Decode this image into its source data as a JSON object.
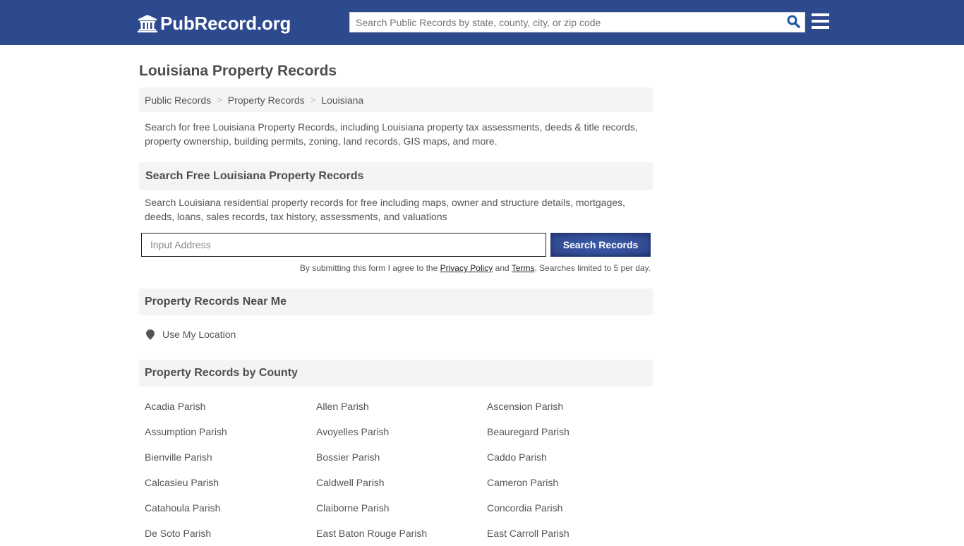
{
  "header": {
    "logo_text": "PubRecord.org",
    "search_placeholder": "Search Public Records by state, county, city, or zip code",
    "search_value": "",
    "icons": {
      "logo": "courthouse-icon",
      "search": "search-icon",
      "menu": "hamburger-menu-icon"
    },
    "colors": {
      "bar": "#2e4a8f",
      "search_icon": "#1d5a9e"
    }
  },
  "page": {
    "title": "Louisiana Property Records",
    "breadcrumb": [
      {
        "label": "Public Records"
      },
      {
        "label": "Property Records"
      },
      {
        "label": "Louisiana"
      }
    ],
    "breadcrumb_separator": ">",
    "intro": "Search for free Louisiana Property Records, including Louisiana property tax assessments, deeds & title records, property ownership, building permits, zoning, land records, GIS maps, and more."
  },
  "search_section": {
    "heading": "Search Free Louisiana Property Records",
    "description": "Search Louisiana residential property records for free including maps, owner and structure details, mortgages, deeds, loans, sales records, tax history, assessments, and valuations",
    "address_placeholder": "Input Address",
    "address_value": "",
    "button_label": "Search Records",
    "disclaimer": {
      "prefix": "By submitting this form I agree to the ",
      "privacy_link": "Privacy Policy",
      "middle": " and ",
      "terms_link": "Terms",
      "suffix": ". Searches limited to 5 per day."
    },
    "colors": {
      "button": "#334d96"
    }
  },
  "near_me": {
    "heading": "Property Records Near Me",
    "location_label": "Use My Location",
    "icon": "map-pin-icon"
  },
  "counties": {
    "heading": "Property Records by County",
    "items": [
      "Acadia Parish",
      "Allen Parish",
      "Ascension Parish",
      "Assumption Parish",
      "Avoyelles Parish",
      "Beauregard Parish",
      "Bienville Parish",
      "Bossier Parish",
      "Caddo Parish",
      "Calcasieu Parish",
      "Caldwell Parish",
      "Cameron Parish",
      "Catahoula Parish",
      "Claiborne Parish",
      "Concordia Parish",
      "De Soto Parish",
      "East Baton Rouge Parish",
      "East Carroll Parish"
    ]
  }
}
